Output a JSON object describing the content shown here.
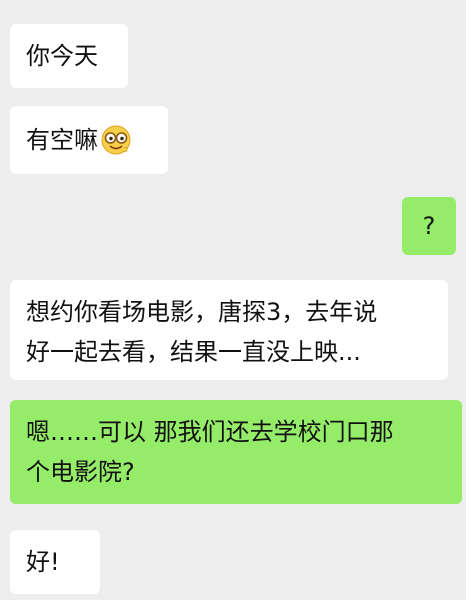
{
  "messages": [
    {
      "side": "received",
      "text": "你今天"
    },
    {
      "side": "received",
      "text": "有空嘛",
      "emoji": "smiling-face-with-glasses-icon"
    },
    {
      "side": "sent",
      "text": "?"
    },
    {
      "side": "received",
      "lines": [
        "想约你看场电影，唐探3，去年说",
        "好一起去看，结果一直没上映..."
      ]
    },
    {
      "side": "sent",
      "lines": [
        "嗯……可以 那我们还去学校门口那",
        "个电影院?"
      ]
    },
    {
      "side": "received",
      "text": "好!"
    }
  ],
  "colors": {
    "background": "#ededed",
    "received_bubble": "#ffffff",
    "sent_bubble": "#95ec69",
    "text": "#111111"
  }
}
